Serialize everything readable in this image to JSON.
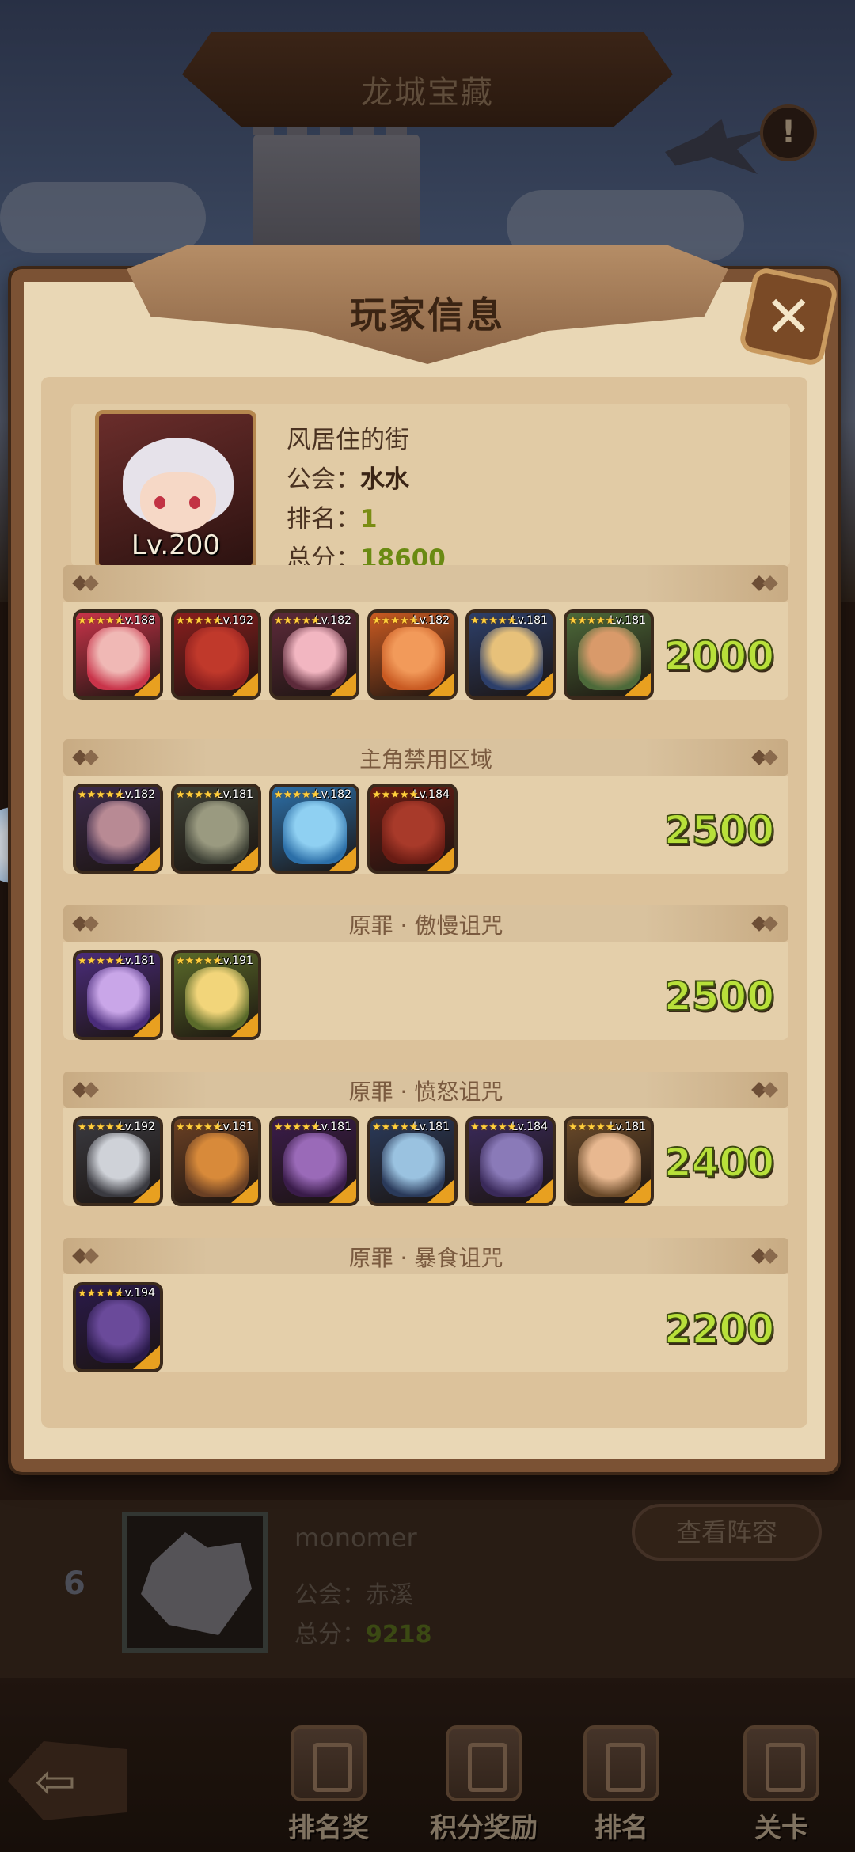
{
  "top_title": "龙城宝藏",
  "popup": {
    "title": "玩家信息",
    "player": {
      "name": "风居住的街",
      "guild_label": "公会：",
      "guild": "水水",
      "rank_label": "排名：",
      "rank": "1",
      "score_label": "总分：",
      "score": "18600",
      "level": "Lv.200"
    },
    "sections": [
      {
        "title": "",
        "score": "2000",
        "heroes": [
          {
            "level": "Lv.188",
            "color": "#c9344a",
            "art": "#f0b8b5"
          },
          {
            "level": "Lv.192",
            "color": "#8a1e1e",
            "art": "#c0392b"
          },
          {
            "level": "Lv.182",
            "color": "#5c2a3a",
            "art": "#f2b6c1"
          },
          {
            "level": "Lv.182",
            "color": "#c95a22",
            "art": "#f29a5a"
          },
          {
            "level": "Lv.181",
            "color": "#2d3f6a",
            "art": "#e7c17a"
          },
          {
            "level": "Lv.181",
            "color": "#4d6a3a",
            "art": "#d99a6a"
          }
        ]
      },
      {
        "title": "主角禁用区域",
        "score": "2500",
        "heroes": [
          {
            "level": "Lv.182",
            "color": "#3b2a4a",
            "art": "#b88a94"
          },
          {
            "level": "Lv.181",
            "color": "#3d4035",
            "art": "#9a9a80"
          },
          {
            "level": "Lv.182",
            "color": "#2c6fa8",
            "art": "#8fd0f2"
          },
          {
            "level": "Lv.184",
            "color": "#6a1c14",
            "art": "#a83a2a"
          }
        ]
      },
      {
        "title": "原罪 · 傲慢诅咒",
        "score": "2500",
        "heroes": [
          {
            "level": "Lv.181",
            "color": "#4a2c7a",
            "art": "#c9a6e8"
          },
          {
            "level": "Lv.191",
            "color": "#5a6a2a",
            "art": "#f2d57a"
          }
        ]
      },
      {
        "title": "原罪 · 愤怒诅咒",
        "score": "2400",
        "heroes": [
          {
            "level": "Lv.192",
            "color": "#3a3a40",
            "art": "#cfd2d8"
          },
          {
            "level": "Lv.181",
            "color": "#6a4024",
            "art": "#d88a3a"
          },
          {
            "level": "Lv.181",
            "color": "#3a1c4a",
            "art": "#9a6ab8"
          },
          {
            "level": "Lv.181",
            "color": "#2a3a5a",
            "art": "#9ac2e0"
          },
          {
            "level": "Lv.184",
            "color": "#3a2a5a",
            "art": "#8a7ab8"
          },
          {
            "level": "Lv.181",
            "color": "#6a4a2a",
            "art": "#e8b890"
          }
        ]
      },
      {
        "title": "原罪 · 暴食诅咒",
        "score": "2200",
        "heroes": [
          {
            "level": "Lv.194",
            "color": "#2a1a4a",
            "art": "#6a4a9a"
          }
        ]
      }
    ]
  },
  "list_entry": {
    "rank": "6",
    "name": "monomer",
    "guild_label": "公会：",
    "guild": "赤溪",
    "score_label": "总分：",
    "score": "9218",
    "view_button": "查看阵容"
  },
  "nav": {
    "items": [
      "排名奖",
      "积分奖励",
      "排名",
      "关卡"
    ]
  },
  "colors": {
    "panel_bg": "#e9d7b5",
    "panel_border": "#7b5234",
    "score_green": "#b8e03a"
  },
  "icons": {
    "info": "exclamation-icon",
    "close": "close-icon",
    "back": "back-arrow-icon"
  }
}
